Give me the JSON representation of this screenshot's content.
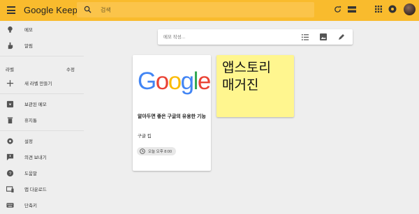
{
  "header": {
    "app_title_google": "Google",
    "app_title_keep": "Keep",
    "search_placeholder": "검색",
    "accent_color": "#f9bb2d"
  },
  "sidebar": {
    "items": [
      {
        "label": "메모",
        "icon": "lightbulb-icon"
      },
      {
        "label": "알림",
        "icon": "reminder-hand-icon"
      },
      {
        "label": "새 라벨 만들기",
        "icon": "plus-icon"
      },
      {
        "label": "보관된 메모",
        "icon": "archive-icon"
      },
      {
        "label": "휴지통",
        "icon": "trash-icon"
      },
      {
        "label": "설정",
        "icon": "gear-icon"
      },
      {
        "label": "의견 보내기",
        "icon": "feedback-icon"
      },
      {
        "label": "도움말",
        "icon": "help-icon"
      },
      {
        "label": "앱 다운로드",
        "icon": "devices-icon"
      },
      {
        "label": "단축키",
        "icon": "keyboard-icon"
      }
    ],
    "labels_header": "라벨",
    "labels_edit": "수정"
  },
  "composer": {
    "placeholder": "메모 작성..."
  },
  "notes": [
    {
      "image_text": "Google",
      "title": "알아두면 좋은 구글의 유용한 기능",
      "body": "구글 킵",
      "reminder": "오늘 오후 8:00"
    },
    {
      "handwriting_line1": "앱스토리",
      "handwriting_line2": "매거진",
      "color": "#fff68f"
    }
  ]
}
